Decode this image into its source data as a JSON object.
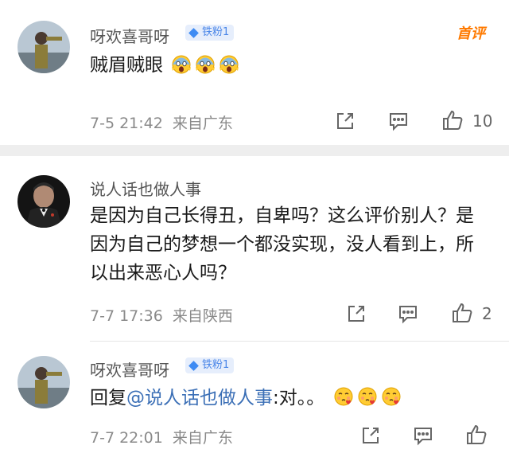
{
  "comments": [
    {
      "username": "呀欢喜哥呀",
      "badge": "铁粉1",
      "text": "贼眉贼眼",
      "emoji_count": 3,
      "emoji_name": "scream-face-emoji",
      "tag": "首评",
      "time": "7-5 21:42",
      "location": "来自广东",
      "likes": "10"
    },
    {
      "username": "说人话也做人事",
      "text": "是因为自己长得丑，自卑吗？这么评价别人？是因为自己的梦想一个都没实现，没人看到上，所以出来恶心人吗？",
      "time": "7-7 17:36",
      "location": "来自陕西",
      "likes": "2"
    },
    {
      "username": "呀欢喜哥呀",
      "badge": "铁粉1",
      "reply_prefix": "回复",
      "mention": "@说人话也做人事",
      "reply_text": ":对。。",
      "emoji_count": 3,
      "emoji_name": "heart-kiss-emoji",
      "time": "7-7 22:01",
      "location": "来自广东",
      "likes": ""
    }
  ],
  "colors": {
    "badge_bg": "#e6eefc",
    "badge_text": "#4a86e8",
    "mention": "#3b6fb6",
    "tag": "#ff7a00",
    "meta": "#8a8a8a"
  },
  "icons": [
    "share-icon",
    "comment-icon",
    "like-icon",
    "diamond-icon"
  ]
}
